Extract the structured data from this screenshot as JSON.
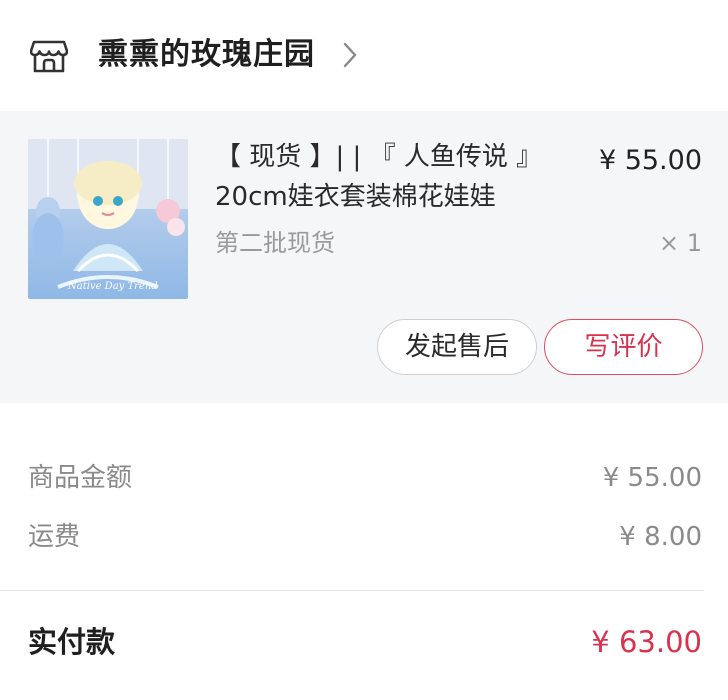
{
  "shop": {
    "name": "熏熏的玫瑰庄园",
    "icon": "storefront-icon",
    "chevron": "chevron-right-icon"
  },
  "item": {
    "title_line1": "【 现货 】| | 『 人鱼传说 』",
    "title_line2": "20cm娃衣套装棉花娃娃",
    "variant": "第二批现货",
    "price": "¥ 55.00",
    "quantity": "× 1",
    "thumbnail_caption": "Native Day Trend",
    "buttons": {
      "aftersale": "发起售后",
      "review": "写评价"
    }
  },
  "summary": {
    "goods_label": "商品金额",
    "goods_value": "¥ 55.00",
    "shipping_label": "运费",
    "shipping_value": "¥ 8.00",
    "total_label": "实付款",
    "total_value": "¥ 63.00"
  },
  "colors": {
    "accent": "#d8324e",
    "card_bg": "#f5f6f8",
    "muted": "#9a9a9a"
  }
}
